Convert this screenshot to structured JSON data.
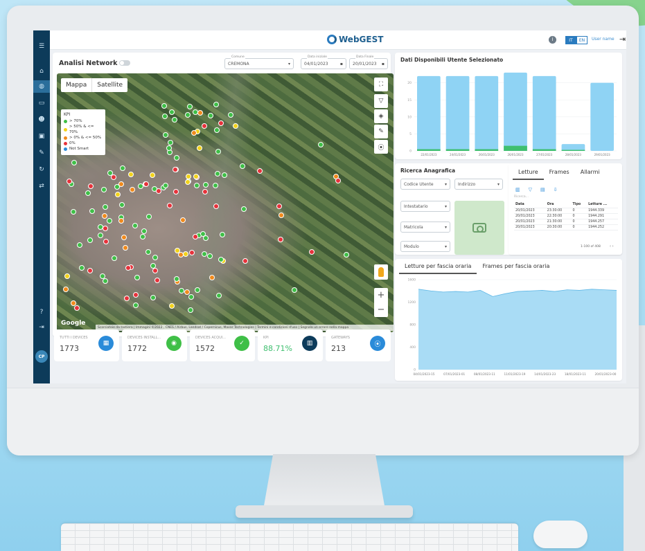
{
  "app": {
    "logo_text": "WebGEST",
    "lang_it": "IT",
    "lang_en": "EN",
    "user_name": "User name",
    "avatar_initials": "CP"
  },
  "network": {
    "title": "Analisi Network",
    "comune_label": "Comune",
    "comune_value": "CREMONA",
    "data_iniziale_label": "Data iniziale",
    "data_iniziale_value": "04/01/2023",
    "data_finale_label": "Data Finale",
    "data_finale_value": "20/01/2023"
  },
  "map": {
    "tab_map": "Mappa",
    "tab_satellite": "Satellite",
    "legend_title": "KPI",
    "legend": [
      {
        "label": "> 70%",
        "color": "#3fbf47"
      },
      {
        "label": "> 50% & <= 70%",
        "color": "#f2d21b"
      },
      {
        "label": "> 0% & <= 50%",
        "color": "#f08a1c"
      },
      {
        "label": "0%",
        "color": "#e6323b"
      },
      {
        "label": "Not Smart",
        "color": "#2a8bd9"
      }
    ],
    "google": "Google",
    "attribution": "Scorciatoie da tastiera | Immagini ©2023 , CNES / Airbus, Landsat / Copernicus, Maxar Technologies | Termini e condizioni d'uso | Segnala un errore nella mappa"
  },
  "kpis": [
    {
      "label": "TUTTI I DEVICES",
      "value": "1773",
      "icon": "building-icon",
      "color": "#2a8bd9"
    },
    {
      "label": "DEVICES INSTALL...",
      "value": "1772",
      "icon": "device-icon",
      "color": "#3fbf47"
    },
    {
      "label": "DEVICES ACQUI...",
      "value": "1572",
      "icon": "check-icon",
      "color": "#3fbf47"
    },
    {
      "label": "KPI",
      "value": "88.71%",
      "icon": "chart-icon",
      "color": "#0d3b5a"
    },
    {
      "label": "GATEWAYS",
      "value": "213",
      "icon": "antenna-icon",
      "color": "#2a8bd9"
    }
  ],
  "dati": {
    "title": "Dati Disponibili Utente Selezionato"
  },
  "chart_data": [
    {
      "type": "bar",
      "categories": [
        "22/01/2023",
        "24/01/2023",
        "26/01/2023",
        "26/01/2023",
        "27/01/2023",
        "28/01/2023",
        "29/01/2023"
      ],
      "series": [
        {
          "values": [
            22,
            22,
            22,
            23,
            22,
            2,
            20
          ],
          "color": "#8fd3f4"
        },
        {
          "values": [
            0.5,
            0.5,
            0.5,
            1.5,
            0.5,
            0.3,
            0
          ],
          "color": "#3fbf6f"
        }
      ],
      "yticks": [
        "0",
        "5",
        "10",
        "15",
        "20"
      ],
      "ylim": [
        0,
        24
      ]
    },
    {
      "type": "area",
      "title": "",
      "x_ticks": [
        "04/01/2023-15",
        "07/01/2023-01",
        "08/01/2023-11",
        "11/01/2023-19",
        "14/01/2023-23",
        "18/01/2023-11",
        "20/01/2023-00"
      ],
      "values": [
        1430,
        1400,
        1380,
        1390,
        1380,
        1410,
        1300,
        1350,
        1390,
        1400,
        1410,
        1390,
        1420,
        1410,
        1430,
        1420,
        1410
      ],
      "yticks": [
        "0",
        "400",
        "800",
        "1200",
        "1600"
      ],
      "ylim": [
        0,
        1600
      ]
    }
  ],
  "ricerca": {
    "title": "Ricerca Anagrafica",
    "codice_utente": "Codice Utente",
    "indirizzo": "Indirizzo",
    "intestatario": "Intestatario",
    "matricola": "Matricola",
    "modulo": "Modulo"
  },
  "letture": {
    "tabs": [
      "Letture",
      "Frames",
      "Allarmi"
    ],
    "search_placeholder": "Ricerca...",
    "columns": [
      "Data",
      "Ora",
      "Tipo",
      "Letture ..."
    ],
    "rows": [
      [
        "20/01/2023",
        "23:30:00",
        "0",
        "1944.339"
      ],
      [
        "20/01/2023",
        "22:30:00",
        "0",
        "1944.291"
      ],
      [
        "20/01/2023",
        "21:30:00",
        "0",
        "1944.257"
      ],
      [
        "20/01/2023",
        "20:30:00",
        "0",
        "1944.252"
      ]
    ],
    "pagination": "1-100 of 408"
  },
  "fascia": {
    "tab1": "Letture per fascia oraria",
    "tab2": "Frames per fascia oraria"
  }
}
